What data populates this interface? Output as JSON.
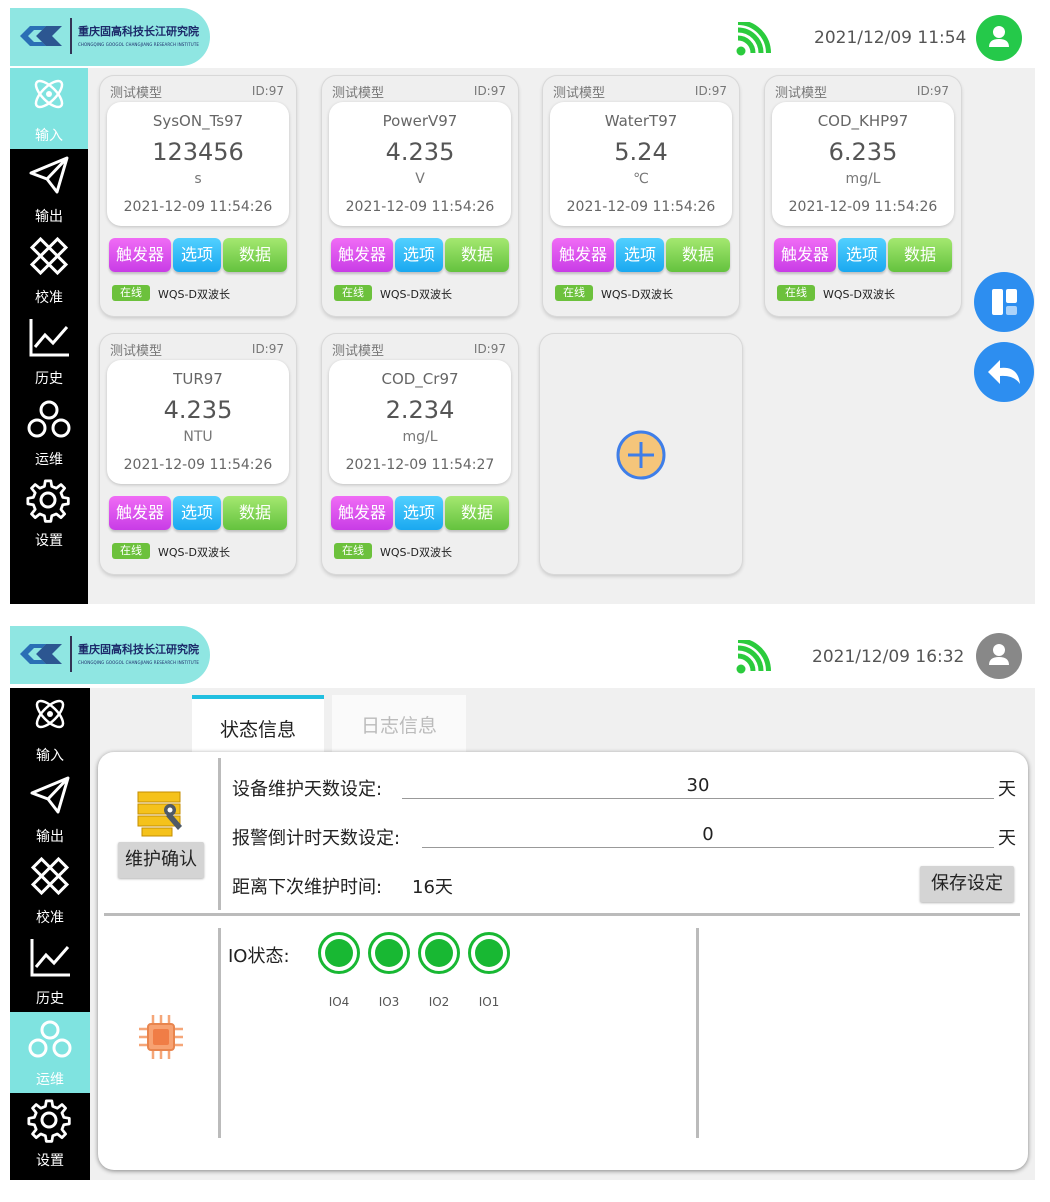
{
  "logo": {
    "name_cn": "重庆固高科技长江研究院",
    "name_en": "CHONGQING GOOGOL CHANGJIANG RESEARCH INSTITUTE"
  },
  "screen1": {
    "datetime": "2021/12/09 11:54",
    "nav": [
      {
        "label": "输入",
        "icon": "atom-icon",
        "active": true
      },
      {
        "label": "输出",
        "icon": "paper-plane-icon"
      },
      {
        "label": "校准",
        "icon": "ruler-pencil-icon"
      },
      {
        "label": "历史",
        "icon": "line-chart-icon"
      },
      {
        "label": "运维",
        "icon": "network-icon"
      },
      {
        "label": "设置",
        "icon": "gear-icon"
      }
    ],
    "cards": [
      {
        "model_label": "测试模型",
        "id": "ID:97",
        "name": "SysON_Ts97",
        "value": "123456",
        "unit": "s",
        "time": "2021-12-09 11:54:26",
        "status": "在线",
        "model": "WQS-D双波长"
      },
      {
        "model_label": "测试模型",
        "id": "ID:97",
        "name": "PowerV97",
        "value": "4.235",
        "unit": "V",
        "time": "2021-12-09 11:54:26",
        "status": "在线",
        "model": "WQS-D双波长"
      },
      {
        "model_label": "测试模型",
        "id": "ID:97",
        "name": "WaterT97",
        "value": "5.24",
        "unit": "℃",
        "time": "2021-12-09 11:54:26",
        "status": "在线",
        "model": "WQS-D双波长"
      },
      {
        "model_label": "测试模型",
        "id": "ID:97",
        "name": "COD_KHP97",
        "value": "6.235",
        "unit": "mg/L",
        "time": "2021-12-09 11:54:26",
        "status": "在线",
        "model": "WQS-D双波长"
      },
      {
        "model_label": "测试模型",
        "id": "ID:97",
        "name": "TUR97",
        "value": "4.235",
        "unit": "NTU",
        "time": "2021-12-09 11:54:26",
        "status": "在线",
        "model": "WQS-D双波长"
      },
      {
        "model_label": "测试模型",
        "id": "ID:97",
        "name": "COD_Cr97",
        "value": "2.234",
        "unit": "mg/L",
        "time": "2021-12-09 11:54:27",
        "status": "在线",
        "model": "WQS-D双波长"
      }
    ],
    "buttons": {
      "trigger": "触发器",
      "option": "选项",
      "data": "数据"
    }
  },
  "screen2": {
    "datetime": "2021/12/09 16:32",
    "nav": [
      {
        "label": "输入",
        "icon": "atom-icon"
      },
      {
        "label": "输出",
        "icon": "paper-plane-icon"
      },
      {
        "label": "校准",
        "icon": "ruler-pencil-icon"
      },
      {
        "label": "历史",
        "icon": "line-chart-icon"
      },
      {
        "label": "运维",
        "icon": "network-icon",
        "active": true
      },
      {
        "label": "设置",
        "icon": "gear-icon"
      }
    ],
    "tabs": [
      {
        "label": "状态信息",
        "active": true
      },
      {
        "label": "日志信息"
      }
    ],
    "maintain": {
      "confirm_btn": "维护确认",
      "days_label": "设备维护天数设定:",
      "days_value": "30",
      "days_unit": "天",
      "alarm_label": "报警倒计时天数设定:",
      "alarm_value": "0",
      "alarm_unit": "天",
      "next_label": "距离下次维护时间:",
      "next_value": "16天",
      "save_btn": "保存设定"
    },
    "io": {
      "label": "IO状态:",
      "items": [
        {
          "name": "IO4"
        },
        {
          "name": "IO3"
        },
        {
          "name": "IO2"
        },
        {
          "name": "IO1"
        }
      ]
    }
  },
  "colors": {
    "accent": "#7fe3e0",
    "online": "#6cc13c",
    "io_on": "#18b833",
    "fab": "#2d8ef0"
  }
}
